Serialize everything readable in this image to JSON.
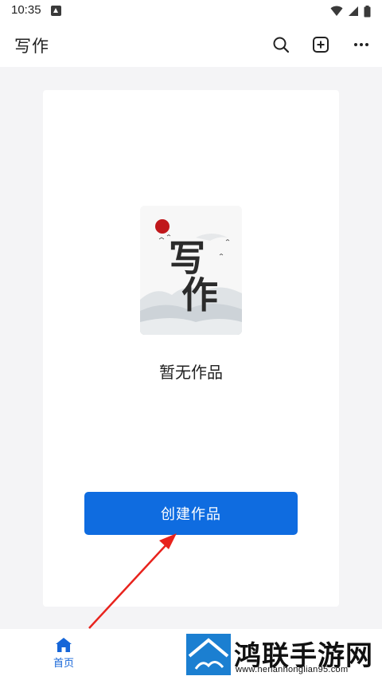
{
  "status_bar": {
    "time": "10:35",
    "icons": [
      "notification-icon",
      "wifi-icon",
      "signal-icon",
      "battery-icon"
    ]
  },
  "header": {
    "title": "写作",
    "actions": [
      "search-icon",
      "add-square-icon",
      "more-icon"
    ]
  },
  "cover": {
    "title_chars": [
      "写",
      "作"
    ],
    "sun_color": "#c0171b"
  },
  "empty_state": {
    "message": "暂无作品"
  },
  "create_button": {
    "label": "创建作品",
    "color": "#0f6ce0"
  },
  "bottom_nav": {
    "items": [
      {
        "label": "首页",
        "icon": "home-icon",
        "active": true,
        "color": "#1565d8"
      }
    ]
  },
  "watermark": {
    "name": "鸿联手游网",
    "url": "www.henanhonglian95.com"
  },
  "annotation": {
    "type": "red-arrow",
    "color": "#e8231d",
    "points_to": "create_button"
  }
}
